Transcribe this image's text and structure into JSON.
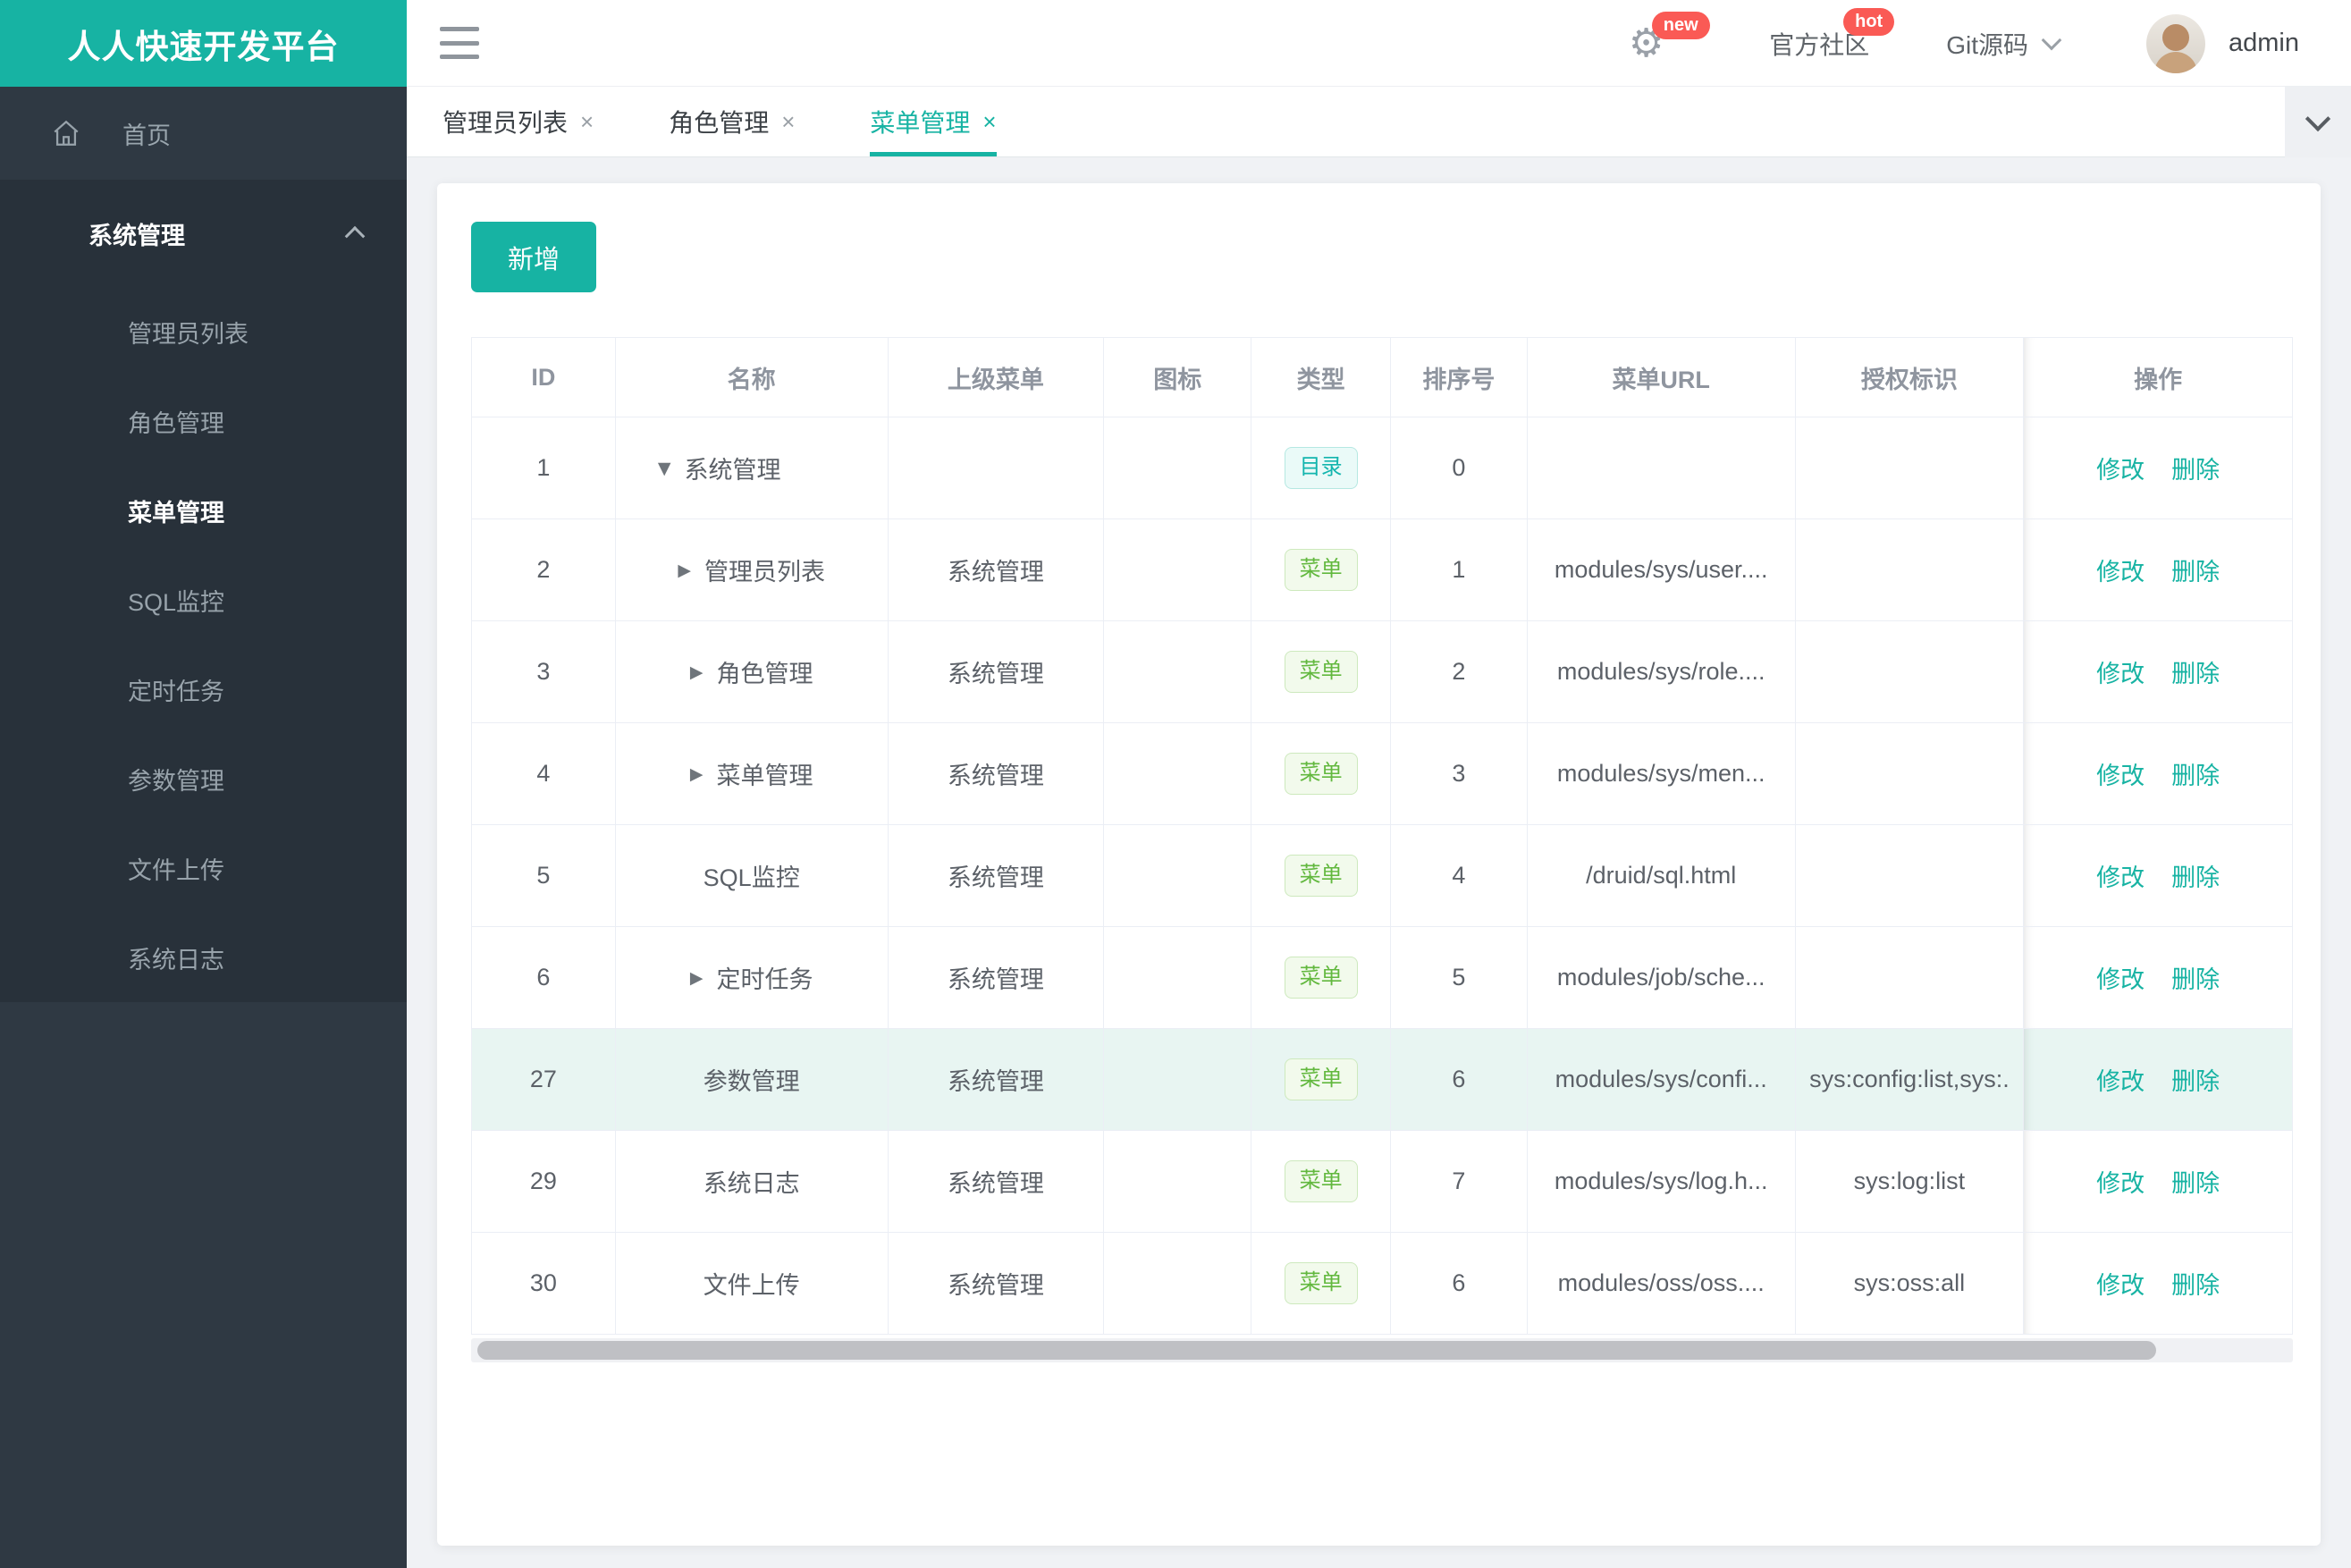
{
  "app": {
    "logo_title": "人人快速开发平台"
  },
  "colors": {
    "accent": "#17b3a3",
    "badge_red": "#fa5a55",
    "tag_dir": "#13b5ae",
    "tag_menu": "#62b83e",
    "row_highlight": "#e8f5f2"
  },
  "topbar": {
    "new_badge": "new",
    "community_label": "官方社区",
    "hot_badge": "hot",
    "git_label": "Git源码",
    "username": "admin"
  },
  "tabs": [
    {
      "label": "管理员列表"
    },
    {
      "label": "角色管理"
    },
    {
      "label": "菜单管理"
    }
  ],
  "sidebar": {
    "home_label": "首页",
    "group_label": "系统管理",
    "items": [
      {
        "label": "管理员列表"
      },
      {
        "label": "角色管理"
      },
      {
        "label": "菜单管理"
      },
      {
        "label": "SQL监控"
      },
      {
        "label": "定时任务"
      },
      {
        "label": "参数管理"
      },
      {
        "label": "文件上传"
      },
      {
        "label": "系统日志"
      }
    ]
  },
  "toolbar": {
    "add_label": "新增"
  },
  "table": {
    "columns": [
      "ID",
      "名称",
      "上级菜单",
      "图标",
      "类型",
      "排序号",
      "菜单URL",
      "授权标识",
      "操作"
    ],
    "actions": {
      "edit": "修改",
      "delete": "删除"
    },
    "rows": [
      {
        "id": "1",
        "arrow_glyph": "▼",
        "name": "系统管理",
        "parent": "",
        "type_label": "目录",
        "type_style": "dir",
        "sort": "0",
        "url": "",
        "perms": "",
        "highlight": false
      },
      {
        "id": "2",
        "arrow_glyph": "▶",
        "name": "管理员列表",
        "parent": "系统管理",
        "type_label": "菜单",
        "type_style": "menu",
        "sort": "1",
        "url": "modules/sys/user....",
        "perms": "",
        "highlight": false
      },
      {
        "id": "3",
        "arrow_glyph": "▶",
        "name": "角色管理",
        "parent": "系统管理",
        "type_label": "菜单",
        "type_style": "menu",
        "sort": "2",
        "url": "modules/sys/role....",
        "perms": "",
        "highlight": false
      },
      {
        "id": "4",
        "arrow_glyph": "▶",
        "name": "菜单管理",
        "parent": "系统管理",
        "type_label": "菜单",
        "type_style": "menu",
        "sort": "3",
        "url": "modules/sys/men...",
        "perms": "",
        "highlight": false
      },
      {
        "id": "5",
        "arrow_glyph": "",
        "name": "SQL监控",
        "parent": "系统管理",
        "type_label": "菜单",
        "type_style": "menu",
        "sort": "4",
        "url": "/druid/sql.html",
        "perms": "",
        "highlight": false
      },
      {
        "id": "6",
        "arrow_glyph": "▶",
        "name": "定时任务",
        "parent": "系统管理",
        "type_label": "菜单",
        "type_style": "menu",
        "sort": "5",
        "url": "modules/job/sche...",
        "perms": "",
        "highlight": false
      },
      {
        "id": "27",
        "arrow_glyph": "",
        "name": "参数管理",
        "parent": "系统管理",
        "type_label": "菜单",
        "type_style": "menu",
        "sort": "6",
        "url": "modules/sys/confi...",
        "perms": "sys:config:list,sys:.",
        "highlight": true
      },
      {
        "id": "29",
        "arrow_glyph": "",
        "name": "系统日志",
        "parent": "系统管理",
        "type_label": "菜单",
        "type_style": "menu",
        "sort": "7",
        "url": "modules/sys/log.h...",
        "perms": "sys:log:list",
        "highlight": false
      },
      {
        "id": "30",
        "arrow_glyph": "",
        "name": "文件上传",
        "parent": "系统管理",
        "type_label": "菜单",
        "type_style": "menu",
        "sort": "6",
        "url": "modules/oss/oss....",
        "perms": "sys:oss:all",
        "highlight": false
      }
    ]
  }
}
